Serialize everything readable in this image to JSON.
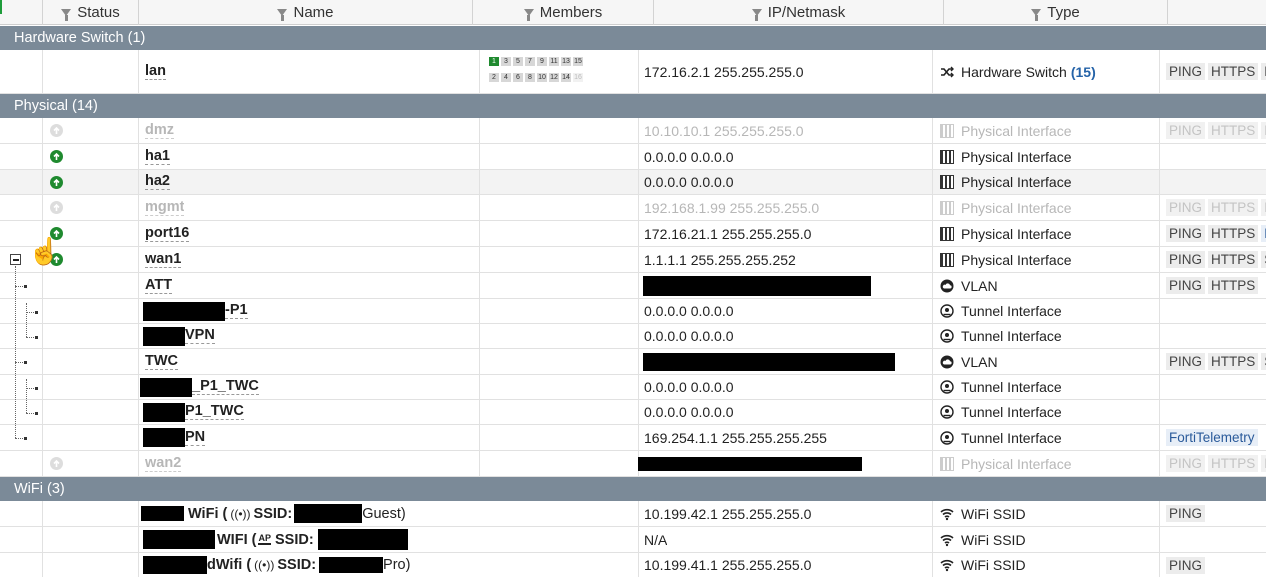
{
  "header": {
    "columns": [
      {
        "label": "Status",
        "filter_icon": "funnel-icon"
      },
      {
        "label": "Name",
        "filter_icon": "funnel-icon"
      },
      {
        "label": "Members",
        "filter_icon": "funnel-icon"
      },
      {
        "label": "IP/Netmask",
        "filter_icon": "funnel-icon"
      },
      {
        "label": "Type",
        "filter_icon": "funnel-icon"
      }
    ]
  },
  "groups": {
    "hardware": "Hardware Switch (1)",
    "physical": "Physical (14)",
    "wifi": "WiFi (3)"
  },
  "rows": {
    "lan": {
      "name": "lan",
      "ip": "172.16.2.1 255.255.255.0",
      "type": "Hardware Switch",
      "count": "(15)",
      "tags": [
        "PING",
        "HTTPS",
        "H"
      ]
    },
    "dmz": {
      "name": "dmz",
      "ip": "10.10.10.1 255.255.255.0",
      "type": "Physical Interface",
      "tags": [
        "PING",
        "HTTPS",
        "H"
      ]
    },
    "ha1": {
      "name": "ha1",
      "ip": "0.0.0.0 0.0.0.0",
      "type": "Physical Interface"
    },
    "ha2": {
      "name": "ha2",
      "ip": "0.0.0.0 0.0.0.0",
      "type": "Physical Interface"
    },
    "mgmt": {
      "name": "mgmt",
      "ip": "192.168.1.99 255.255.255.0",
      "type": "Physical Interface",
      "tags": [
        "PING",
        "HTTPS",
        "H"
      ]
    },
    "port16": {
      "name": "port16",
      "ip": "172.16.21.1 255.255.255.0",
      "type": "Physical Interface",
      "tags": [
        "PING",
        "HTTPS",
        "F"
      ]
    },
    "wan1": {
      "name": "wan1",
      "ip": "1.1.1.1 255.255.255.252",
      "type": "Physical Interface",
      "tags": [
        "PING",
        "HTTPS",
        "S"
      ]
    },
    "att": {
      "name": "ATT",
      "type": "VLAN",
      "tags": [
        "PING",
        "HTTPS"
      ]
    },
    "p1": {
      "name_suffix": "-P1",
      "ip": "0.0.0.0 0.0.0.0",
      "type": "Tunnel Interface"
    },
    "vpn": {
      "name_suffix": "VPN",
      "ip": "0.0.0.0 0.0.0.0",
      "type": "Tunnel Interface"
    },
    "twc": {
      "name": "TWC",
      "type": "VLAN",
      "tags": [
        "PING",
        "HTTPS",
        "S"
      ]
    },
    "p1twc_a": {
      "name_suffix": "_P1_TWC",
      "ip": "0.0.0.0 0.0.0.0",
      "type": "Tunnel Interface"
    },
    "p1twc_b": {
      "name_suffix": "P1_TWC",
      "ip": "0.0.0.0 0.0.0.0",
      "type": "Tunnel Interface"
    },
    "pn": {
      "name_suffix": "PN",
      "ip": "169.254.1.1 255.255.255.255",
      "type": "Tunnel Interface",
      "tag": "FortiTelemetry"
    },
    "wan2": {
      "name": "wan2",
      "type": "Physical Interface",
      "tags": [
        "PING",
        "HTTPS",
        "F"
      ]
    },
    "wifi1": {
      "name_a": "WiFi (",
      "ssid_label": "SSID:",
      "name_b": "Guest)",
      "ip": "10.199.42.1 255.255.255.0",
      "type": "WiFi SSID",
      "tags": [
        "PING"
      ]
    },
    "wifi2": {
      "name_a": "WIFI (",
      "ap": "AP",
      "ssid_label": "SSID:",
      "ip": "N/A",
      "type": "WiFi SSID"
    },
    "wifi3": {
      "name_a": "dWifi (",
      "ssid_label": "SSID:",
      "name_b": "Pro)",
      "ip": "10.199.41.1 255.255.255.0",
      "type": "WiFi SSID",
      "tags": [
        "PING"
      ]
    }
  },
  "ports": {
    "top": [
      "1",
      "3",
      "5",
      "7",
      "9",
      "11",
      "13",
      "15"
    ],
    "bottom": [
      "2",
      "4",
      "6",
      "8",
      "10",
      "12",
      "14",
      "16"
    ]
  },
  "colors": {
    "accent": "#1f8a2f",
    "group": "#7b8a98",
    "link": "#2563a8"
  }
}
